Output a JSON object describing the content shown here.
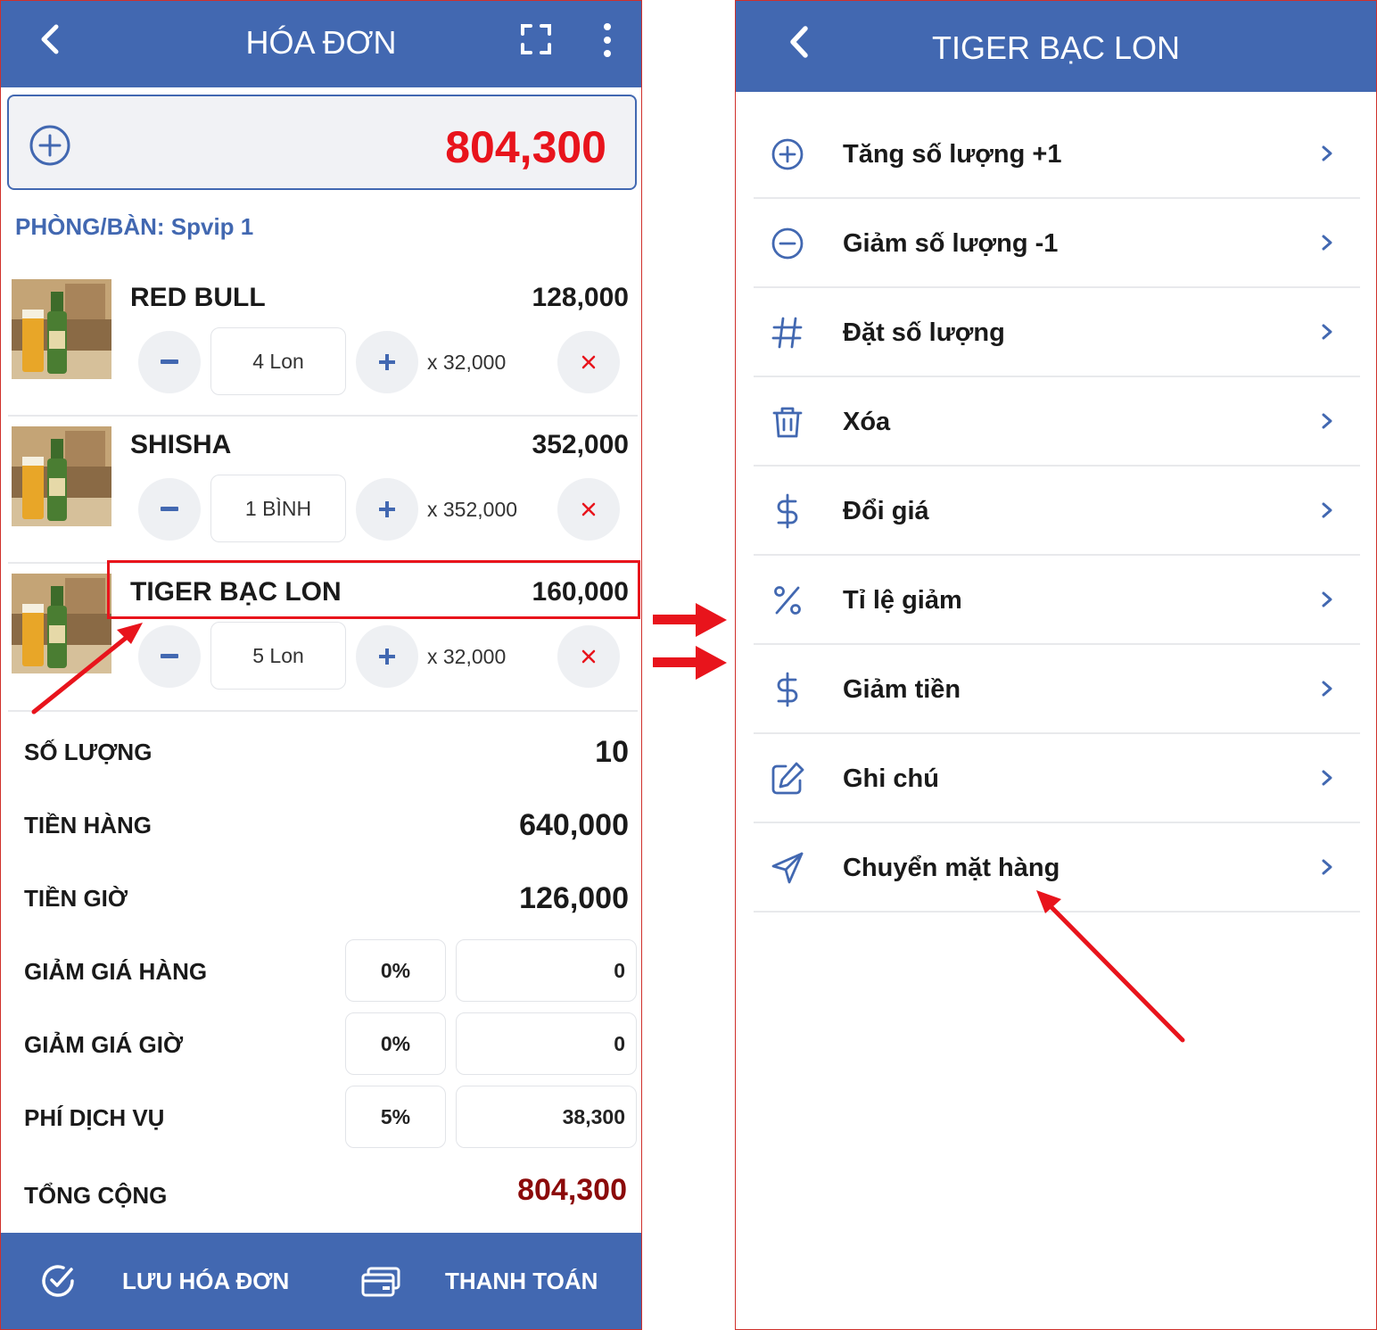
{
  "invoice_screen": {
    "title": "HÓA ĐƠN",
    "total_top": "804,300",
    "room_label": "PHÒNG/BÀN: Spvip 1",
    "items": [
      {
        "name": "RED BULL",
        "total": "128,000",
        "qty": "4 Lon",
        "unit_price": "x 32,000"
      },
      {
        "name": "SHISHA",
        "total": "352,000",
        "qty": "1 BÌNH",
        "unit_price": "x 352,000"
      },
      {
        "name": "TIGER BẠC LON",
        "total": "160,000",
        "qty": "5 Lon",
        "unit_price": "x 32,000"
      }
    ],
    "summary": {
      "quantity_label": "SỐ LƯỢNG",
      "quantity_value": "10",
      "goods_label": "TIỀN HÀNG",
      "goods_value": "640,000",
      "hours_label": "TIỀN GIỜ",
      "hours_value": "126,000",
      "goods_discount_label": "GIẢM GIÁ HÀNG",
      "goods_discount_pct": "0%",
      "goods_discount_amount": "0",
      "hours_discount_label": "GIẢM GIÁ GIỜ",
      "hours_discount_pct": "0%",
      "hours_discount_amount": "0",
      "service_fee_label": "PHÍ DỊCH VỤ",
      "service_fee_pct": "5%",
      "service_fee_amount": "38,300",
      "grand_total_label": "TỔNG CỘNG",
      "grand_total_value": "804,300"
    },
    "bottom": {
      "save_label": "LƯU HÓA ĐƠN",
      "pay_label": "THANH TOÁN"
    }
  },
  "item_menu_screen": {
    "title": "TIGER BẠC LON",
    "options": [
      {
        "label": "Tăng số lượng +1",
        "icon": "plus-circle-icon"
      },
      {
        "label": "Giảm số lượng -1",
        "icon": "minus-circle-icon"
      },
      {
        "label": "Đặt số lượng",
        "icon": "hash-icon"
      },
      {
        "label": "Xóa",
        "icon": "trash-icon"
      },
      {
        "label": "Đổi giá",
        "icon": "dollar-icon"
      },
      {
        "label": "Tỉ lệ giảm",
        "icon": "percent-icon"
      },
      {
        "label": "Giảm tiền",
        "icon": "dollar-icon"
      },
      {
        "label": "Ghi chú",
        "icon": "edit-icon"
      },
      {
        "label": "Chuyển mặt hàng",
        "icon": "send-icon"
      }
    ]
  },
  "colors": {
    "primary": "#4268b1",
    "total_red": "#e8141c",
    "grand_total": "#8b0a0a",
    "annotation_red": "#e8141c"
  }
}
